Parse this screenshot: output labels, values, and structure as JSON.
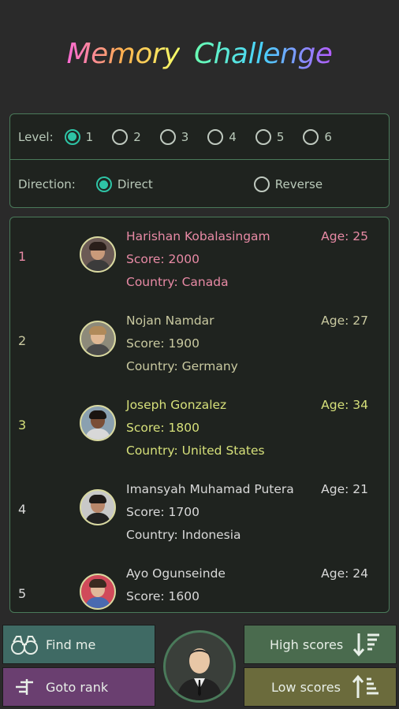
{
  "app": {
    "title_part1": "Memory",
    "title_part2": "Challenge"
  },
  "settings": {
    "level_label": "Level:",
    "levels": [
      "1",
      "2",
      "3",
      "4",
      "5",
      "6"
    ],
    "selected_level": "1",
    "direction_label": "Direction:",
    "directions": [
      "Direct",
      "Reverse"
    ],
    "selected_direction": "Direct"
  },
  "scores": [
    {
      "rank": "1",
      "name": "Harishan Kobalasingam",
      "age": "Age: 25",
      "score": "Score: 2000",
      "country": "Country: Canada",
      "text_color": "#e88aa5",
      "rank_color": "#e88aa5"
    },
    {
      "rank": "2",
      "name": "Nojan Namdar",
      "age": "Age: 27",
      "score": "Score: 1900",
      "country": "Country: Germany",
      "text_color": "#c9c9a0",
      "rank_color": "#c9c9a0"
    },
    {
      "rank": "3",
      "name": "Joseph Gonzalez",
      "age": "Age: 34",
      "score": "Score: 1800",
      "country": "Country: United States",
      "text_color": "#d6e07a",
      "rank_color": "#d6e07a"
    },
    {
      "rank": "4",
      "name": "Imansyah Muhamad Putera",
      "age": "Age: 21",
      "score": "Score: 1700",
      "country": "Country: Indonesia",
      "text_color": "#d9d9d9",
      "rank_color": "#d9d9d9"
    },
    {
      "rank": "5",
      "name": "Ayo Ogunseinde",
      "age": "Age: 24",
      "score": "Score: 1600",
      "country": "",
      "text_color": "#d9d9d9",
      "rank_color": "#d9d9d9"
    }
  ],
  "buttons": {
    "find_me": "Find me",
    "goto_rank": "Goto rank",
    "high_scores": "High scores",
    "low_scores": "Low scores"
  },
  "icons": {
    "find_me": "binoculars-icon",
    "goto_rank": "list-rank-icon",
    "high_scores": "sort-descending-icon",
    "low_scores": "sort-ascending-icon",
    "profile": "businessman-avatar-icon"
  },
  "colors": {
    "accent": "#2ec4a6",
    "panel_border": "#4a7a5a",
    "background": "#2a2a2a"
  }
}
